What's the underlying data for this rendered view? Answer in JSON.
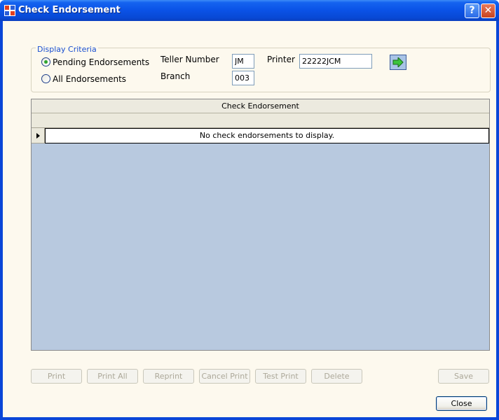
{
  "window": {
    "title": "Check Endorsement",
    "help_label": "?",
    "close_label": "✕"
  },
  "criteria": {
    "legend": "Display Criteria",
    "pending_label": "Pending Endorsements",
    "all_label": "All Endorsements",
    "selected": "pending",
    "teller_label": "Teller Number",
    "teller_value": "JM",
    "branch_label": "Branch",
    "branch_value": "003",
    "printer_label": "Printer",
    "printer_value": "22222JCM",
    "go_icon": "green-arrow-right-icon"
  },
  "grid": {
    "caption": "Check Endorsement",
    "empty_message": "No check endorsements to display."
  },
  "buttons": {
    "print": "Print",
    "print_all": "Print All",
    "reprint": "Reprint",
    "cancel_print": "Cancel Print",
    "test_print": "Test Print",
    "delete": "Delete",
    "save": "Save",
    "close": "Close"
  },
  "colors": {
    "titlebar": "#0a52e6",
    "client_bg": "#fdf9ee",
    "grid_bg": "#b8c9df",
    "legend_text": "#1a4fd0"
  }
}
